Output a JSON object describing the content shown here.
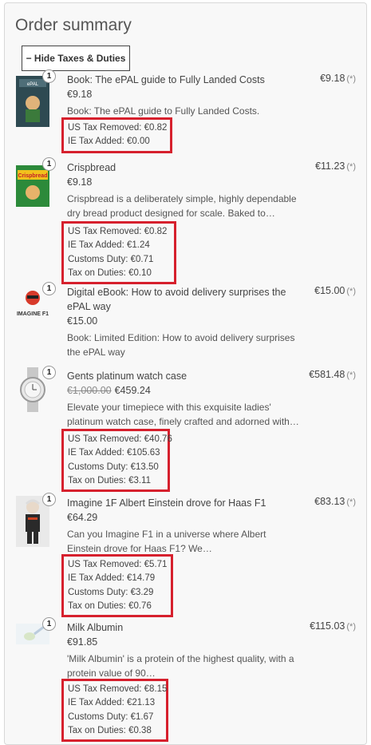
{
  "summary": {
    "title": "Order summary",
    "toggle_label": "− Hide Taxes & Duties"
  },
  "items": [
    {
      "qty": "1",
      "name": "Book: The ePAL guide to Fully Landed Costs",
      "price": "€9.18",
      "old_price": "",
      "desc": "Book: The ePAL guide to Fully Landed Costs.",
      "total": "€9.18",
      "total_note": "(*)",
      "taxes": [
        "US Tax Removed: €0.82",
        "IE Tax Added: €0.00"
      ]
    },
    {
      "qty": "1",
      "name": "Crispbread",
      "price": "€9.18",
      "old_price": "",
      "desc": "Crispbread is a deliberately simple, highly dependable dry bread product designed for scale. Baked to…",
      "total": "€11.23",
      "total_note": "(*)",
      "taxes": [
        "US Tax Removed: €0.82",
        "IE Tax Added: €1.24",
        "Customs Duty: €0.71",
        "Tax on Duties: €0.10"
      ]
    },
    {
      "qty": "1",
      "name": "Digital eBook: How to avoid delivery surprises the ePAL way",
      "price": "€15.00",
      "old_price": "",
      "desc": "Book: Limited Edition: How to avoid delivery surprises the ePAL way",
      "total": "€15.00",
      "total_note": "(*)",
      "thumb_text": "IMAGINE F1",
      "taxes": []
    },
    {
      "qty": "1",
      "name": "Gents platinum watch case",
      "price": "€459.24",
      "old_price": "€1,000.00",
      "desc": "Elevate your timepiece with this exquisite ladies' platinum watch case, finely crafted and adorned with…",
      "total": "€581.48",
      "total_note": "(*)",
      "taxes": [
        "US Tax Removed: €40.76",
        "IE Tax Added: €105.63",
        "Customs Duty: €13.50",
        "Tax on Duties: €3.11"
      ]
    },
    {
      "qty": "1",
      "name": "Imagine 1F Albert Einstein drove for Haas F1",
      "price": "€64.29",
      "old_price": "",
      "desc": "Can you Imagine F1 in a universe where Albert Einstein drove for Haas F1? We…",
      "total": "€83.13",
      "total_note": "(*)",
      "taxes": [
        "US Tax Removed: €5.71",
        "IE Tax Added: €14.79",
        "Customs Duty: €3.29",
        "Tax on Duties: €0.76"
      ]
    },
    {
      "qty": "1",
      "name": "Milk Albumin",
      "price": "€91.85",
      "old_price": "",
      "desc": "'Milk Albumin' is a protein of the highest quality, with a protein value of 90…",
      "total": "€115.03",
      "total_note": "(*)",
      "taxes": [
        "US Tax Removed: €8.15",
        "IE Tax Added: €21.13",
        "Customs Duty: €1.67",
        "Tax on Duties: €0.38"
      ]
    }
  ]
}
